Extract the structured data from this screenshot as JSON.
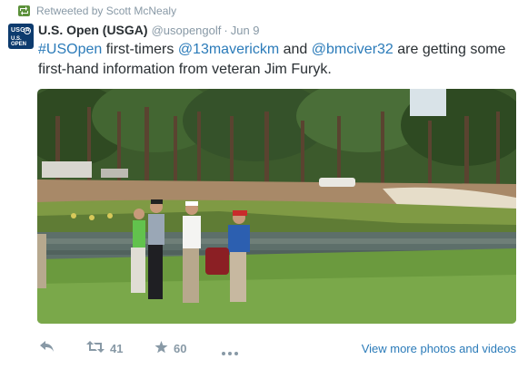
{
  "retweet": {
    "text": "Retweeted by Scott McNealy"
  },
  "avatar": {
    "line1": "USGA",
    "line2": "U.S. OPEN"
  },
  "tweet": {
    "name": "U.S. Open (USGA)",
    "handle": "@usopengolf",
    "separator": "·",
    "time": "Jun 9",
    "text_parts": {
      "hashtag": "#USOpen",
      "t1": " first-timers ",
      "mention1": "@13maverickm",
      "t2": " and ",
      "mention2": "@bmciver32",
      "t3": " are getting some first-hand information from veteran Jim Furyk."
    }
  },
  "actions": {
    "retweets": "41",
    "favorites": "60",
    "view_more": "View more photos and videos"
  },
  "colors": {
    "link": "#2b7bb9",
    "muted": "#8899a6",
    "retweet_badge": "#5c913b",
    "avatar_bg": "#0d3b6e"
  },
  "icons": [
    "retweet-icon",
    "reply-icon",
    "favorite-star-icon",
    "more-ellipsis-icon"
  ]
}
